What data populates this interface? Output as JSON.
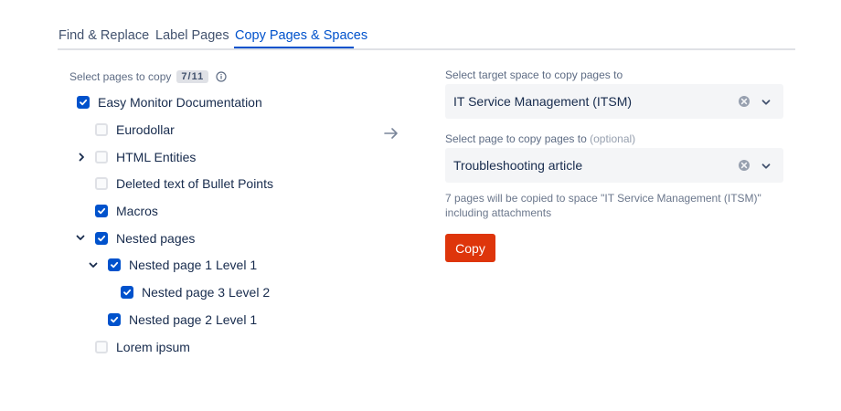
{
  "tabs": [
    {
      "label": "Find & Replace",
      "active": false
    },
    {
      "label": "Label Pages",
      "active": false
    },
    {
      "label": "Copy Pages & Spaces",
      "active": true
    }
  ],
  "left": {
    "select_label": "Select pages to copy",
    "count": "7/11",
    "tree": [
      {
        "label": "Easy Monitor Documentation",
        "checked": true,
        "expander": "none"
      },
      {
        "label": "Eurodollar",
        "checked": false,
        "expander": "none"
      },
      {
        "label": "HTML Entities",
        "checked": false,
        "expander": "collapsed"
      },
      {
        "label": "Deleted text of Bullet Points",
        "checked": false,
        "expander": "none"
      },
      {
        "label": "Macros",
        "checked": true,
        "expander": "none"
      },
      {
        "label": "Nested pages",
        "checked": true,
        "expander": "expanded"
      },
      {
        "label": "Nested page 1 Level 1",
        "checked": true,
        "expander": "expanded"
      },
      {
        "label": "Nested page 3 Level 2",
        "checked": true,
        "expander": "none"
      },
      {
        "label": "Nested page 2 Level 1",
        "checked": true,
        "expander": "none"
      },
      {
        "label": "Lorem ipsum",
        "checked": false,
        "expander": "none"
      }
    ]
  },
  "right": {
    "target_space_label": "Select target space to copy pages to",
    "target_space_value": "IT Service Management (ITSM)",
    "target_page_label": "Select page to copy pages to",
    "target_page_optional": "(optional)",
    "target_page_value": "Troubleshooting article",
    "help_text": "7 pages will be copied to space \"IT Service Management (ITSM)\" including attachments",
    "copy_label": "Copy"
  },
  "icons": {
    "info": "info-icon",
    "arrow": "arrow-right-icon",
    "clear": "clear-icon",
    "dropdown": "chevron-down-icon",
    "expand": "chevron-right-icon",
    "collapse": "chevron-down-icon"
  },
  "colors": {
    "accent": "#0052cc",
    "copy_button": "#de350b",
    "checkbox_checked": "#0052cc",
    "select_background": "#f4f5f7"
  }
}
